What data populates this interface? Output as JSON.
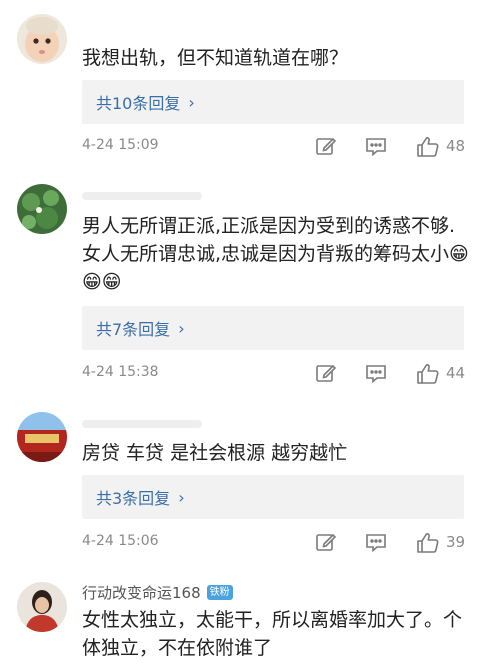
{
  "comments": [
    {
      "text": "我想出轨，但不知道轨道在哪？",
      "reply_label": "共10条回复",
      "time": "4-24 15:09",
      "likes": "48"
    },
    {
      "text": "男人无所谓正派,正派是因为受到的诱惑不够.女人无所谓忠诚,忠诚是因为背叛的筹码太小😁😁😁",
      "reply_label": "共7条回复",
      "time": "4-24 15:38",
      "likes": "44"
    },
    {
      "text": "房贷 车贷 是社会根源 越穷越忙",
      "reply_label": "共3条回复",
      "time": "4-24 15:06",
      "likes": "39"
    },
    {
      "username": "行动改变命运168",
      "badge": "铁粉",
      "text": "女性太独立，太能干，所以离婚率加大了。个体独立，不在依附谁了"
    }
  ],
  "icons": {
    "edit": "edit-icon",
    "reply": "comment-icon",
    "like": "thumbs-up-icon",
    "more": "chevron-right-icon"
  },
  "colors": {
    "link": "#3b6ea8",
    "meta": "#8a8a8a",
    "reply_bg": "#f2f2f2",
    "badge": "#4aa3df"
  }
}
